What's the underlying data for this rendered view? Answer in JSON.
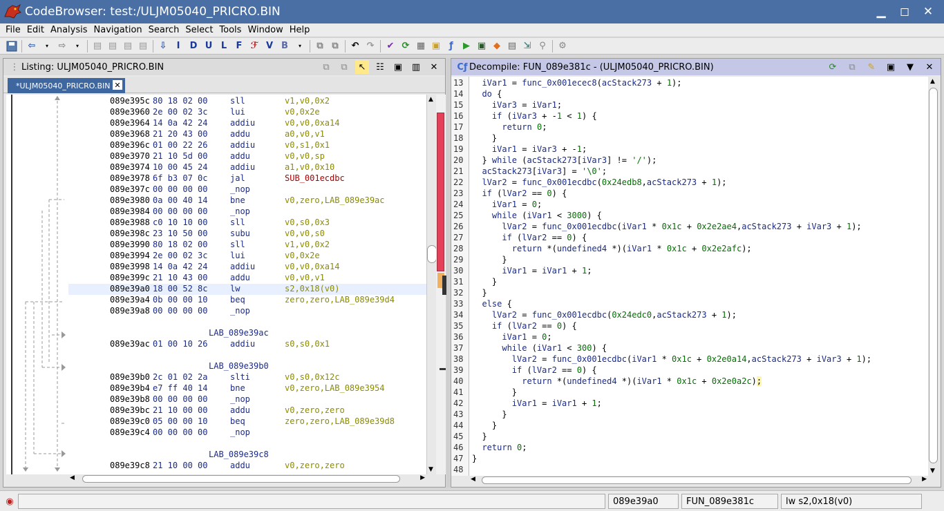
{
  "window": {
    "title": "CodeBrowser: test:/ULJM05040_PRICRO.BIN",
    "minimize": "▁",
    "maximize": "◻",
    "close": "✕"
  },
  "menu": [
    "File",
    "Edit",
    "Analysis",
    "Navigation",
    "Search",
    "Select",
    "Tools",
    "Window",
    "Help"
  ],
  "toolbar": {
    "nav_letters": [
      "I",
      "D",
      "U",
      "L",
      "F",
      "V",
      "B"
    ]
  },
  "listing": {
    "title": "Listing:  ULJM05040_PRICRO.BIN",
    "tab": "*ULJM05040_PRICRO.BIN",
    "rows": [
      {
        "addr": "089e395c",
        "bytes": "80 18 02 00",
        "mn": "sll",
        "ops": "v1,v0,0x2"
      },
      {
        "addr": "089e3960",
        "bytes": "2e 00 02 3c",
        "mn": "lui",
        "ops": "v0,0x2e"
      },
      {
        "addr": "089e3964",
        "bytes": "14 0a 42 24",
        "mn": "addiu",
        "ops": "v0,v0,0xa14"
      },
      {
        "addr": "089e3968",
        "bytes": "21 20 43 00",
        "mn": "addu",
        "ops": "a0,v0,v1"
      },
      {
        "addr": "089e396c",
        "bytes": "01 00 22 26",
        "mn": "addiu",
        "ops": "v0,s1,0x1"
      },
      {
        "addr": "089e3970",
        "bytes": "21 10 5d 00",
        "mn": "addu",
        "ops": "v0,v0,sp"
      },
      {
        "addr": "089e3974",
        "bytes": "10 00 45 24",
        "mn": "addiu",
        "ops": "a1,v0,0x10"
      },
      {
        "addr": "089e3978",
        "bytes": "6f b3 07 0c",
        "mn": "jal",
        "ops": "SUB_001ecdbc"
      },
      {
        "addr": "089e397c",
        "bytes": "00 00 00 00",
        "mn": "_nop",
        "ops": ""
      },
      {
        "addr": "089e3980",
        "bytes": "0a 00 40 14",
        "mn": "bne",
        "ops": "v0,zero,LAB_089e39ac"
      },
      {
        "addr": "089e3984",
        "bytes": "00 00 00 00",
        "mn": "_nop",
        "ops": ""
      },
      {
        "addr": "089e3988",
        "bytes": "c0 10 10 00",
        "mn": "sll",
        "ops": "v0,s0,0x3"
      },
      {
        "addr": "089e398c",
        "bytes": "23 10 50 00",
        "mn": "subu",
        "ops": "v0,v0,s0"
      },
      {
        "addr": "089e3990",
        "bytes": "80 18 02 00",
        "mn": "sll",
        "ops": "v1,v0,0x2"
      },
      {
        "addr": "089e3994",
        "bytes": "2e 00 02 3c",
        "mn": "lui",
        "ops": "v0,0x2e"
      },
      {
        "addr": "089e3998",
        "bytes": "14 0a 42 24",
        "mn": "addiu",
        "ops": "v0,v0,0xa14"
      },
      {
        "addr": "089e399c",
        "bytes": "21 10 43 00",
        "mn": "addu",
        "ops": "v0,v0,v1"
      },
      {
        "addr": "089e39a0",
        "bytes": "18 00 52 8c",
        "mn": "lw",
        "ops": "s2,0x18(v0)"
      },
      {
        "addr": "089e39a4",
        "bytes": "0b 00 00 10",
        "mn": "beq",
        "ops": "zero,zero,LAB_089e39d4"
      },
      {
        "addr": "089e39a8",
        "bytes": "00 00 00 00",
        "mn": "_nop",
        "ops": ""
      },
      {
        "label": ""
      },
      {
        "label": "LAB_089e39ac"
      },
      {
        "addr": "089e39ac",
        "bytes": "01 00 10 26",
        "mn": "addiu",
        "ops": "s0,s0,0x1"
      },
      {
        "label": ""
      },
      {
        "label": "LAB_089e39b0"
      },
      {
        "addr": "089e39b0",
        "bytes": "2c 01 02 2a",
        "mn": "slti",
        "ops": "v0,s0,0x12c"
      },
      {
        "addr": "089e39b4",
        "bytes": "e7 ff 40 14",
        "mn": "bne",
        "ops": "v0,zero,LAB_089e3954"
      },
      {
        "addr": "089e39b8",
        "bytes": "00 00 00 00",
        "mn": "_nop",
        "ops": ""
      },
      {
        "addr": "089e39bc",
        "bytes": "21 10 00 00",
        "mn": "addu",
        "ops": "v0,zero,zero"
      },
      {
        "addr": "089e39c0",
        "bytes": "05 00 00 10",
        "mn": "beq",
        "ops": "zero,zero,LAB_089e39d8"
      },
      {
        "addr": "089e39c4",
        "bytes": "00 00 00 00",
        "mn": "_nop",
        "ops": ""
      },
      {
        "label": ""
      },
      {
        "label": "LAB_089e39c8"
      },
      {
        "addr": "089e39c8",
        "bytes": "21 10 00 00",
        "mn": "addu",
        "ops": "v0,zero,zero"
      }
    ]
  },
  "decompile": {
    "title": "Decompile: FUN_089e381c -  (ULJM05040_PRICRO.BIN)",
    "lines": [
      {
        "n": "13",
        "t": "  iVar1 = func_0x001ecec8(acStack273 + 1);"
      },
      {
        "n": "14",
        "t": "  do {"
      },
      {
        "n": "15",
        "t": "    iVar3 = iVar1;"
      },
      {
        "n": "16",
        "t": "    if (iVar3 + -1 < 1) {"
      },
      {
        "n": "17",
        "t": "      return 0;"
      },
      {
        "n": "18",
        "t": "    }"
      },
      {
        "n": "19",
        "t": "    iVar1 = iVar3 + -1;"
      },
      {
        "n": "20",
        "t": "  } while (acStack273[iVar3] != '/');"
      },
      {
        "n": "21",
        "t": "  acStack273[iVar3] = '\\0';"
      },
      {
        "n": "22",
        "t": "  lVar2 = func_0x001ecdbc(0x24edb8,acStack273 + 1);"
      },
      {
        "n": "23",
        "t": "  if (lVar2 == 0) {"
      },
      {
        "n": "24",
        "t": "    iVar1 = 0;"
      },
      {
        "n": "25",
        "t": "    while (iVar1 < 3000) {"
      },
      {
        "n": "26",
        "t": "      lVar2 = func_0x001ecdbc(iVar1 * 0x1c + 0x2e2ae4,acStack273 + iVar3 + 1);"
      },
      {
        "n": "27",
        "t": "      if (lVar2 == 0) {"
      },
      {
        "n": "28",
        "t": "        return *(undefined4 *)(iVar1 * 0x1c + 0x2e2afc);"
      },
      {
        "n": "29",
        "t": "      }"
      },
      {
        "n": "30",
        "t": "      iVar1 = iVar1 + 1;"
      },
      {
        "n": "31",
        "t": "    }"
      },
      {
        "n": "32",
        "t": "  }"
      },
      {
        "n": "33",
        "t": "  else {"
      },
      {
        "n": "34",
        "t": "    lVar2 = func_0x001ecdbc(0x24edc0,acStack273 + 1);"
      },
      {
        "n": "35",
        "t": "    if (lVar2 == 0) {"
      },
      {
        "n": "36",
        "t": "      iVar1 = 0;"
      },
      {
        "n": "37",
        "t": "      while (iVar1 < 300) {"
      },
      {
        "n": "38",
        "t": "        lVar2 = func_0x001ecdbc(iVar1 * 0x1c + 0x2e0a14,acStack273 + iVar3 + 1);"
      },
      {
        "n": "39",
        "t": "        if (lVar2 == 0) {"
      },
      {
        "n": "40",
        "t": "          return *(undefined4 *)(iVar1 * 0x1c + 0x2e0a2c);"
      },
      {
        "n": "41",
        "t": "        }"
      },
      {
        "n": "42",
        "t": "        iVar1 = iVar1 + 1;"
      },
      {
        "n": "43",
        "t": "      }"
      },
      {
        "n": "44",
        "t": "    }"
      },
      {
        "n": "45",
        "t": "  }"
      },
      {
        "n": "46",
        "t": "  return 0;"
      },
      {
        "n": "47",
        "t": "}"
      },
      {
        "n": "48",
        "t": ""
      }
    ]
  },
  "status": {
    "address": "089e39a0",
    "function": "FUN_089e381c",
    "instruction": "lw s2,0x18(v0)"
  },
  "colors": {
    "titlebar": "#4a6fa5",
    "tab_active": "#3e67a0",
    "decomp_header": "#c4c8e6"
  }
}
